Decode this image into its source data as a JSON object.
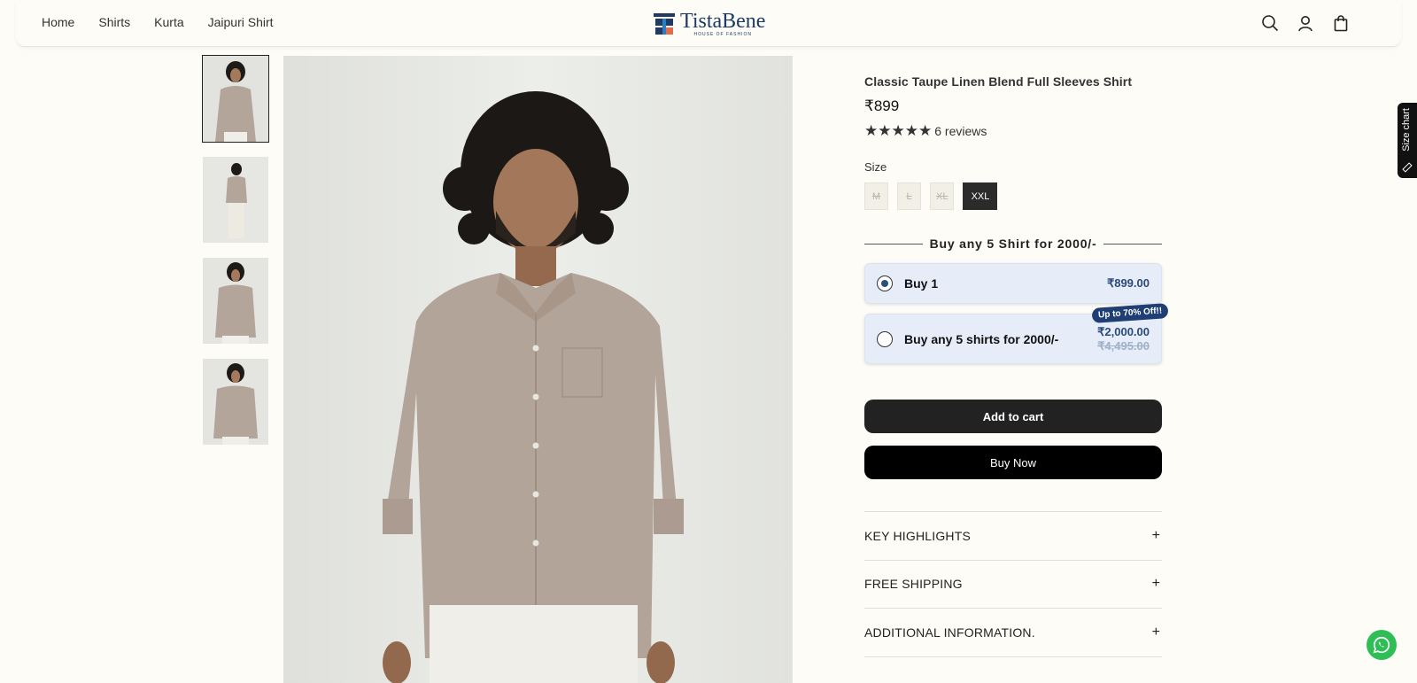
{
  "nav": {
    "items": [
      "Home",
      "Shirts",
      "Kurta",
      "Jaipuri Shirt"
    ]
  },
  "brand": {
    "name": "TistaBene",
    "tagline": "HOUSE OF FASHION"
  },
  "product": {
    "title": "Classic Taupe Linen Blend Full Sleeves Shirt",
    "price": "₹899",
    "rating_stars": 5,
    "reviews": "6 reviews",
    "size_label": "Size",
    "sizes": [
      "M",
      "L",
      "XL",
      "XXL"
    ],
    "selected_size": "XXL"
  },
  "bundle": {
    "heading": "Buy any 5 Shirt for 2000/-",
    "options": [
      {
        "label": "Buy 1",
        "price": "₹899.00",
        "selected": true
      },
      {
        "label": "Buy any 5 shirts for 2000/-",
        "price": "₹2,000.00",
        "compare": "₹4,495.00",
        "badge": "Up to 70% Off!!"
      }
    ]
  },
  "actions": {
    "add_to_cart": "Add to cart",
    "buy_now": "Buy Now"
  },
  "accordion": [
    "KEY HIGHLIGHTS",
    "FREE SHIPPING",
    "ADDITIONAL INFORMATION."
  ],
  "size_chart_tab": "Size chart",
  "colors": {
    "page_bg": "#fdfcf6",
    "brand_navy": "#1f3b63",
    "option_bg": "#e6edf9",
    "badge_bg": "#1f3f74",
    "shirt": "#b3a49a",
    "whatsapp": "#2fbe55"
  },
  "icons": [
    "search-icon",
    "account-icon",
    "cart-bag-icon",
    "star-icon",
    "plus-icon",
    "ruler-icon",
    "whatsapp-icon"
  ]
}
